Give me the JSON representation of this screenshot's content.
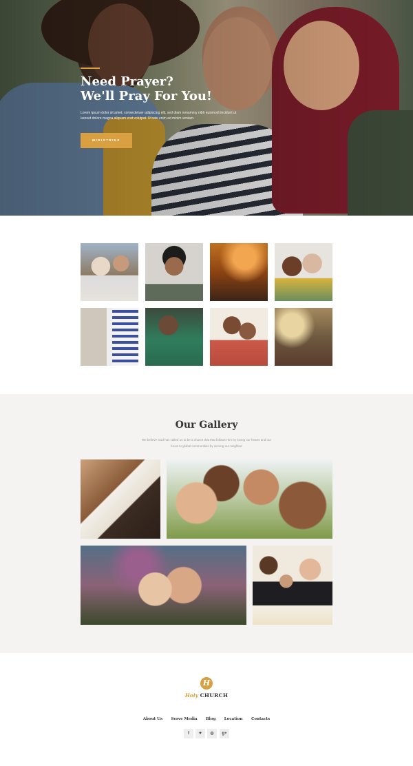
{
  "hero": {
    "title_line1": "Need Prayer?",
    "title_line2": "We'll Pray For You!",
    "body": "Lorem ipsum dolor sit amet, consectetuer adipiscing elit, sed diam nonummy nibh euismod tincidunt ut laoreet dolore magna aliquam erat volutpat. Ut wisi enim ad minim veniam.",
    "button_label": "MINISTRIES",
    "accent": "#d9a041"
  },
  "gallery": {
    "title": "Our Gallery",
    "subtitle": "We believe God has called us to be a church that that follows Him by loving our hearts and our focus to global communities by serving our neighbor"
  },
  "footer": {
    "logo_mark": "H",
    "logo_holy": "Holy",
    "logo_church": "CHURCH",
    "nav": [
      "About Us",
      "Serve Media",
      "Blog",
      "Location",
      "Contacts"
    ],
    "social": [
      {
        "icon": "facebook-icon",
        "glyph": "f"
      },
      {
        "icon": "twitter-icon",
        "glyph": "✦"
      },
      {
        "icon": "instagram-icon",
        "glyph": "◎"
      },
      {
        "icon": "google-plus-icon",
        "glyph": "g+"
      }
    ]
  }
}
